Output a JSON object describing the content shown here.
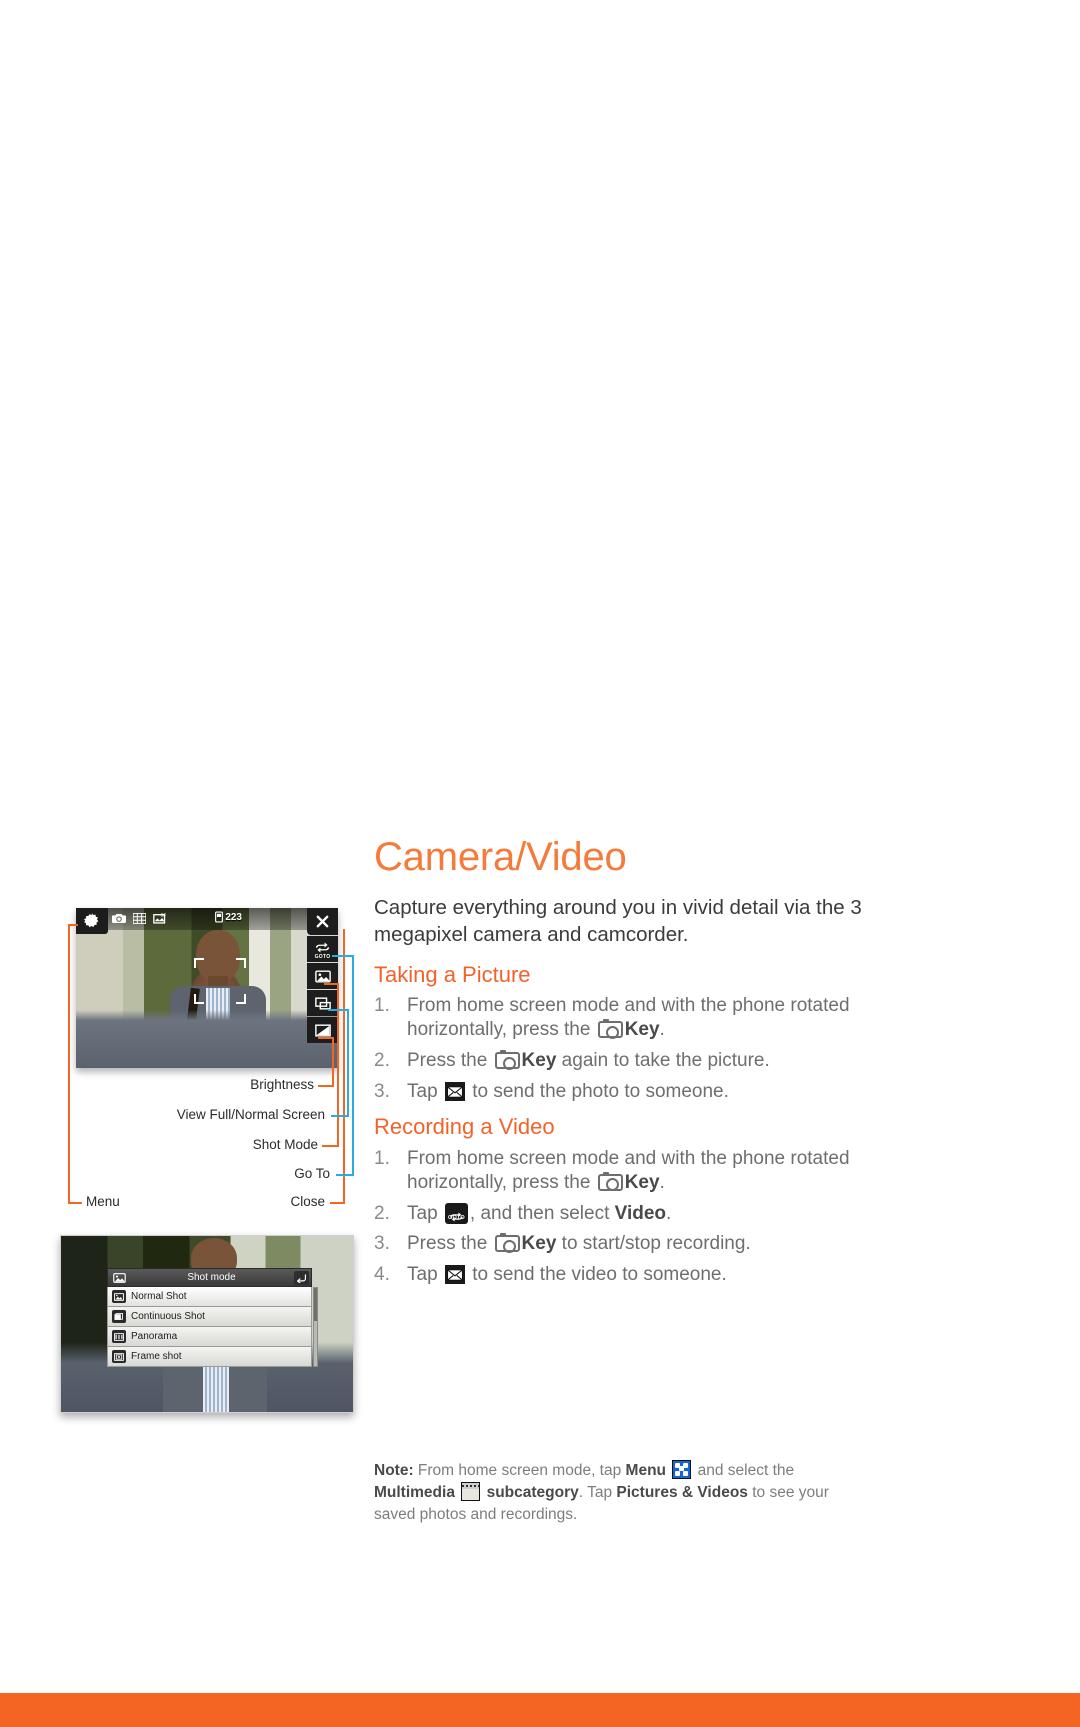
{
  "page": {
    "title": "Camera/Video",
    "intro": "Capture everything around you in vivid detail via the 3 megapixel camera and camcorder."
  },
  "sections": [
    {
      "heading": "Taking a Picture",
      "steps": [
        {
          "num": "1.",
          "text_a": "From home screen mode and with the phone rotated horizontally, press the ",
          "icon": "camera-key-icon",
          "bold": "Key",
          "text_b": "."
        },
        {
          "num": "2.",
          "text_a": "Press the ",
          "icon": "camera-key-icon",
          "bold": "Key",
          "text_b": " again to take the picture."
        },
        {
          "num": "3.",
          "text_a": "Tap ",
          "icon": "envelope-icon",
          "bold": "",
          "text_b": " to send the photo to someone."
        }
      ]
    },
    {
      "heading": "Recording a Video",
      "steps": [
        {
          "num": "1.",
          "text_a": "From home screen mode and with the phone rotated horizontally, press the ",
          "icon": "camera-key-icon",
          "bold": "Key",
          "text_b": "."
        },
        {
          "num": "2.",
          "text_a": "Tap ",
          "icon": "goto-icon",
          "bold": "",
          "text_b": ", and then select ",
          "bold2": "Video",
          "text_c": "."
        },
        {
          "num": "3.",
          "text_a": "Press the ",
          "icon": "camera-key-icon",
          "bold": "Key",
          "text_b": " to start/stop recording."
        },
        {
          "num": "4.",
          "text_a": "Tap ",
          "icon": "envelope-icon",
          "bold": "",
          "text_b": " to send the video to someone."
        }
      ]
    }
  ],
  "note": {
    "label": "Note:",
    "part1": " From home screen mode, tap ",
    "bold1": "Menu",
    "icon1": "menu-grid-icon",
    "part2": " and select the ",
    "bold2": "Multimedia",
    "icon2": "multimedia-film-icon",
    "bold3": "subcategory",
    "part3": ". Tap ",
    "bold4": "Pictures & Videos",
    "part4": " to see your saved photos and recordings."
  },
  "figure1": {
    "name": "camera-viewfinder-screenshot",
    "topbar": {
      "gear": "settings-gear-icon",
      "icons": [
        "camera-mode-icon",
        "grid-icon",
        "scene-icon"
      ],
      "counter": "223",
      "counter_icon": "memory-icon"
    },
    "rail": [
      {
        "name": "close-button",
        "icon": "close-x-icon"
      },
      {
        "name": "goto-button",
        "icon": "goto-icon",
        "label": "GOTO"
      },
      {
        "name": "shot-mode-button",
        "icon": "shot-mode-icon"
      },
      {
        "name": "view-screen-button",
        "icon": "view-screen-icon"
      },
      {
        "name": "brightness-button",
        "icon": "brightness-icon"
      }
    ],
    "callouts": [
      {
        "label": "Brightness"
      },
      {
        "label": "View Full/Normal Screen"
      },
      {
        "label": "Shot Mode"
      },
      {
        "label": "Go To"
      },
      {
        "label": "Close"
      },
      {
        "label": "Menu"
      }
    ]
  },
  "figure2": {
    "name": "shot-mode-menu-screenshot",
    "title": "Shot mode",
    "title_icon": "shot-mode-icon",
    "back_icon": "back-arrow-icon",
    "items": [
      {
        "label": "Normal Shot",
        "icon": "normal-shot-icon",
        "selected": true
      },
      {
        "label": "Continuous Shot",
        "icon": "continuous-shot-icon",
        "selected": false
      },
      {
        "label": "Panorama",
        "icon": "panorama-icon",
        "selected": false
      },
      {
        "label": "Frame shot",
        "icon": "frame-shot-icon",
        "selected": false
      }
    ]
  },
  "colors": {
    "accent": "#f26522",
    "title": "#f47b39",
    "heading": "#f4622b",
    "body": "#6e6e6e",
    "callout_blue": "#29abe2"
  }
}
